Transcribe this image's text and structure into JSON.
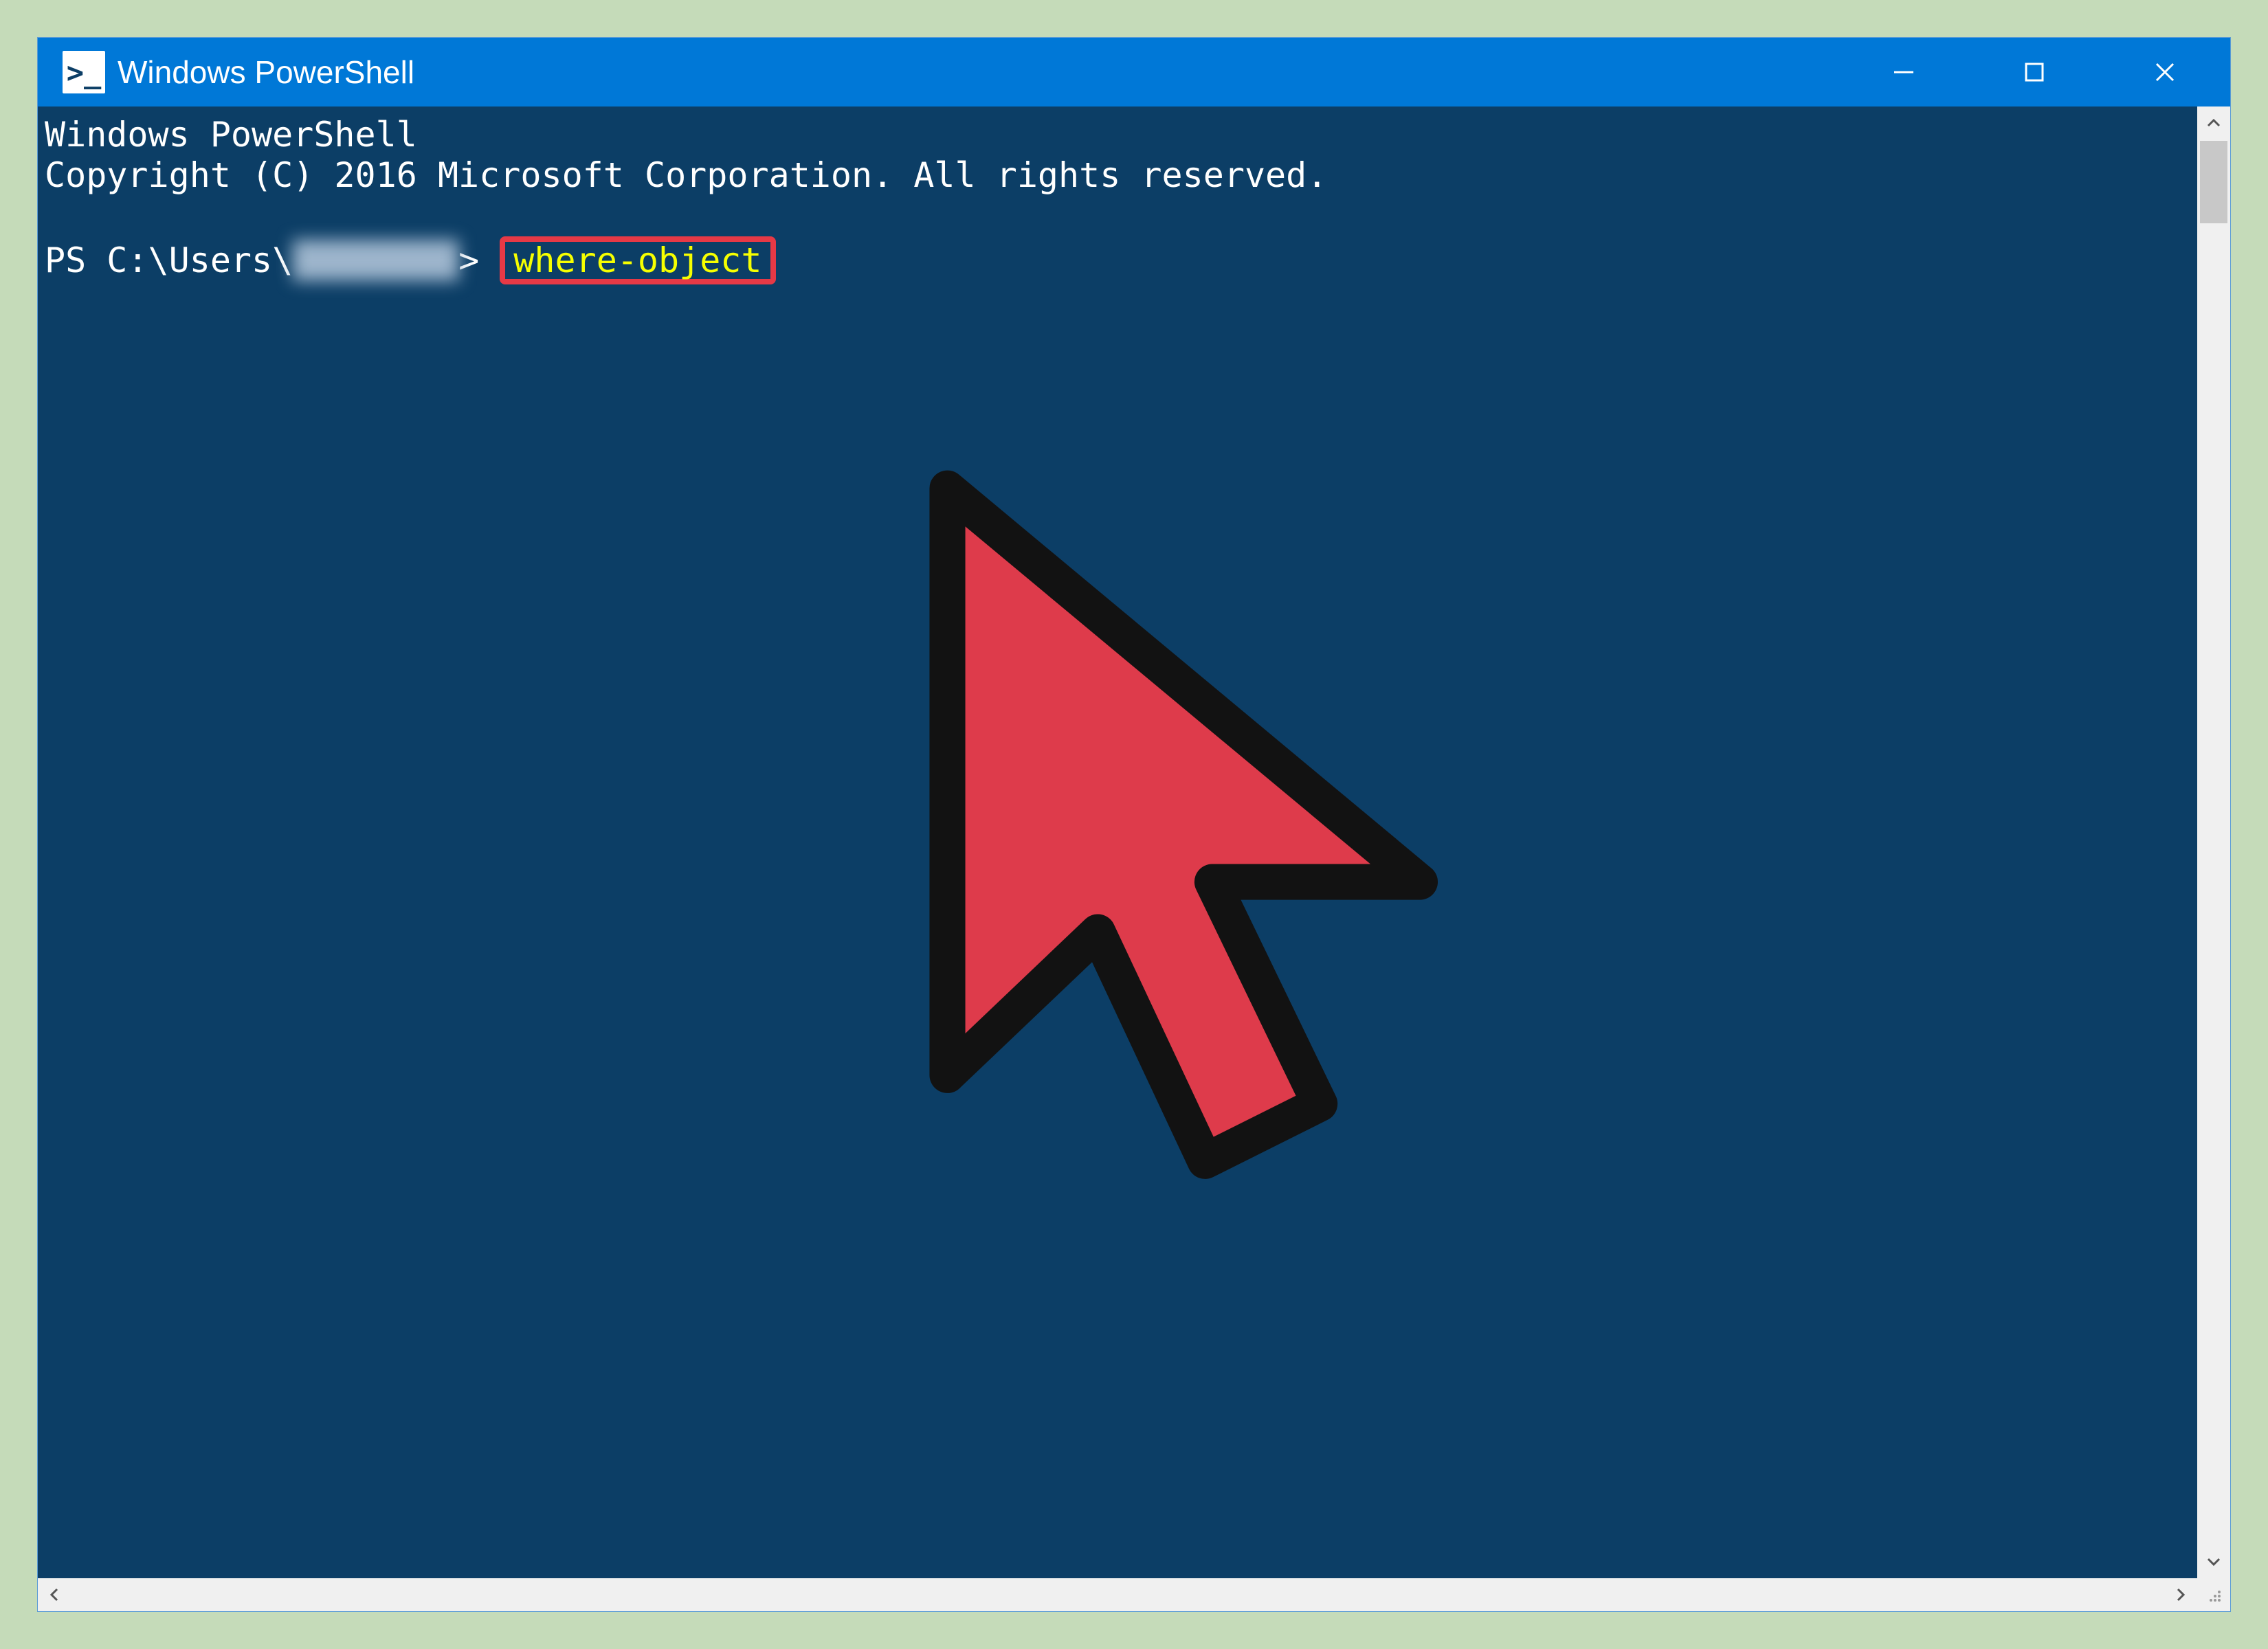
{
  "window": {
    "title": "Windows PowerShell",
    "icon_glyph": ">_"
  },
  "console": {
    "line1": "Windows PowerShell",
    "line2": "Copyright (C) 2016 Microsoft Corporation. All rights reserved.",
    "prompt_prefix": "PS C:\\Users\\",
    "redacted_user": "████████",
    "prompt_suffix": ">",
    "command": "where-object"
  },
  "colors": {
    "titlebar": "#0078d7",
    "console_bg": "#0c3e66",
    "command_fg": "#f6ff00",
    "highlight_border": "#e63946",
    "cursor_fill": "#de3b4b",
    "page_bg": "#c5dbb9"
  }
}
